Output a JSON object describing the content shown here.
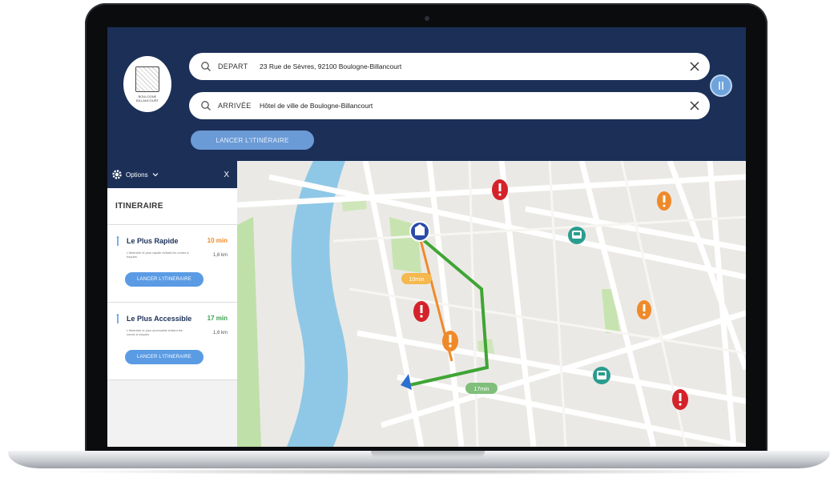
{
  "search": {
    "depart_label": "DEPART",
    "depart_value": "23 Rue de Sèvres, 92100 Boulogne-Billancourt",
    "arrivee_label": "ARRIVÉE",
    "arrivee_value": "Hôtel de ville de Boulogne-Billancourt",
    "clear_icon": "close-icon",
    "search_icon": "search-icon"
  },
  "header": {
    "launch_label": "LANCER L'ITINÉRAIRE",
    "logo_caption": "BOULOGNE BILLANCOURT"
  },
  "panel": {
    "options_label": "Options",
    "close_label": "X",
    "title": "ITINERAIRE",
    "routes": [
      {
        "name": "Le Plus Rapide",
        "time": "10 min",
        "description": "L'itinéraire le plus rapide évitant les zones à risques",
        "distance": "1,6 km",
        "button_label": "LANCER L'ITINERAIRE",
        "time_color": "#ef8a2a"
      },
      {
        "name": "Le Plus Accessible",
        "time": "17 min",
        "description": "L'itinéraire le plus accessible évitant les zones à risques",
        "distance": "1,6 km",
        "button_label": "LANCER L'ITINERAIRE",
        "time_color": "#3aa04a"
      }
    ]
  },
  "map": {
    "orange_route_label": "10min",
    "green_route_label": "17min",
    "colors": {
      "fast_route": "#ef8a2a",
      "accessible_route": "#3fa535",
      "danger_pin": "#d4222a",
      "warning_pin": "#ef8a2a",
      "transit_pin": "#2a9d8f",
      "river": "#8fc8e6",
      "park": "#bfe0a8"
    }
  },
  "theme": {
    "navy": "#1b2f57",
    "accent": "#6b9bd6"
  }
}
